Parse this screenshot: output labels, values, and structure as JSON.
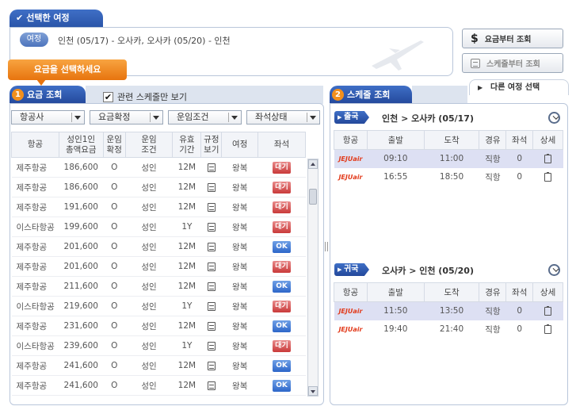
{
  "selected_trip": {
    "tab_title": "선택한 여정",
    "badge": "여정",
    "text": "인천 (05/17) - 오사카, 오사카 (05/20) - 인천"
  },
  "side_buttons": {
    "fare_first": "요금부터 조회",
    "schedule_first": "스케줄부터 조회",
    "other_trip": "다른 여정 선택"
  },
  "callout": "요금을 선택하세요",
  "fare": {
    "tab_number": "1",
    "tab_title": "요금 조회",
    "related_only_label": "관련 스케줄만 보기",
    "dropdowns": [
      "항공사",
      "요금확정",
      "운임조건",
      "좌석상태"
    ],
    "headers": [
      "항공",
      "성인1인\n총액요금",
      "운임\n확정",
      "운임\n조건",
      "유효\n기간",
      "규정\n보기",
      "여정",
      "좌석"
    ],
    "rows": [
      {
        "airline": "제주항공",
        "price": "186,600",
        "confirmed": "O",
        "cond": "성인",
        "validity": "12M",
        "trip": "왕복",
        "seat": "대기",
        "status": "wait"
      },
      {
        "airline": "제주항공",
        "price": "186,600",
        "confirmed": "O",
        "cond": "성인",
        "validity": "12M",
        "trip": "왕복",
        "seat": "대기",
        "status": "wait"
      },
      {
        "airline": "제주항공",
        "price": "191,600",
        "confirmed": "O",
        "cond": "성인",
        "validity": "12M",
        "trip": "왕복",
        "seat": "대기",
        "status": "wait"
      },
      {
        "airline": "이스타항공",
        "price": "199,600",
        "confirmed": "O",
        "cond": "성인",
        "validity": "1Y",
        "trip": "왕복",
        "seat": "대기",
        "status": "wait"
      },
      {
        "airline": "제주항공",
        "price": "201,600",
        "confirmed": "O",
        "cond": "성인",
        "validity": "12M",
        "trip": "왕복",
        "seat": "OK",
        "status": "ok"
      },
      {
        "airline": "제주항공",
        "price": "201,600",
        "confirmed": "O",
        "cond": "성인",
        "validity": "12M",
        "trip": "왕복",
        "seat": "대기",
        "status": "wait"
      },
      {
        "airline": "제주항공",
        "price": "211,600",
        "confirmed": "O",
        "cond": "성인",
        "validity": "12M",
        "trip": "왕복",
        "seat": "OK",
        "status": "ok"
      },
      {
        "airline": "이스타항공",
        "price": "219,600",
        "confirmed": "O",
        "cond": "성인",
        "validity": "1Y",
        "trip": "왕복",
        "seat": "대기",
        "status": "wait"
      },
      {
        "airline": "제주항공",
        "price": "231,600",
        "confirmed": "O",
        "cond": "성인",
        "validity": "12M",
        "trip": "왕복",
        "seat": "OK",
        "status": "ok"
      },
      {
        "airline": "이스타항공",
        "price": "239,600",
        "confirmed": "O",
        "cond": "성인",
        "validity": "1Y",
        "trip": "왕복",
        "seat": "대기",
        "status": "wait"
      },
      {
        "airline": "제주항공",
        "price": "241,600",
        "confirmed": "O",
        "cond": "성인",
        "validity": "12M",
        "trip": "왕복",
        "seat": "OK",
        "status": "ok"
      },
      {
        "airline": "제주항공",
        "price": "241,600",
        "confirmed": "O",
        "cond": "성인",
        "validity": "12M",
        "trip": "왕복",
        "seat": "OK",
        "status": "ok"
      }
    ]
  },
  "schedule": {
    "tab_number": "2",
    "tab_title": "스케줄 조회",
    "headers": [
      "항공",
      "출발",
      "도착",
      "경유",
      "좌석",
      "상세"
    ],
    "outbound": {
      "badge": "출국",
      "route": "인천 > 오사카 (05/17)",
      "rows": [
        {
          "logo": "JEJUair",
          "dep": "09:10",
          "arr": "11:00",
          "via": "직항",
          "seats": "0",
          "selected": true
        },
        {
          "logo": "JEJUair",
          "dep": "16:55",
          "arr": "18:50",
          "via": "직항",
          "seats": "0",
          "selected": false
        }
      ]
    },
    "inbound": {
      "badge": "귀국",
      "route": "오사카 > 인천 (05/20)",
      "rows": [
        {
          "logo": "JEJUair",
          "dep": "11:50",
          "arr": "13:50",
          "via": "직항",
          "seats": "0",
          "selected": true
        },
        {
          "logo": "JEJUair",
          "dep": "19:40",
          "arr": "21:40",
          "via": "직항",
          "seats": "0",
          "selected": false
        }
      ]
    }
  },
  "colors": {
    "accent": "#2a55a9",
    "callout": "#e7740e",
    "wait": "#c93a3a",
    "ok": "#2d66c9",
    "jeju_red": "#e23a1b"
  }
}
